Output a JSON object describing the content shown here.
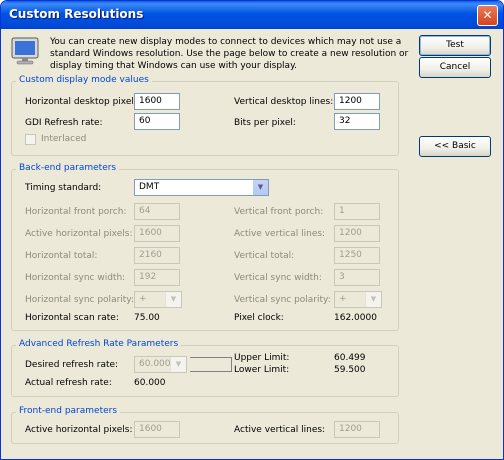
{
  "window": {
    "title": "Custom Resolutions",
    "close_glyph": "✕"
  },
  "intro": "You can create new display modes to connect to devices which may not use a standard Windows resolution. Use the page below to create a new resolution or display timing that Windows can use with your display.",
  "buttons": {
    "test": "Test",
    "cancel": "Cancel",
    "basic": "<< Basic"
  },
  "custom_mode": {
    "legend": "Custom display mode values",
    "h_pixels_label": "Horizontal desktop pixels:",
    "h_pixels": "1600",
    "v_lines_label": "Vertical desktop lines:",
    "v_lines": "1200",
    "gdi_label": "GDI Refresh rate:",
    "gdi": "60",
    "bpp_label": "Bits per pixel:",
    "bpp": "32",
    "interlaced_label": "Interlaced"
  },
  "backend": {
    "legend": "Back-end parameters",
    "timing_label": "Timing standard:",
    "timing": "DMT",
    "h_front_porch_label": "Horizontal front porch:",
    "h_front_porch": "64",
    "v_front_porch_label": "Vertical front porch:",
    "v_front_porch": "1",
    "active_h_label": "Active horizontal pixels:",
    "active_h": "1600",
    "active_v_label": "Active vertical lines:",
    "active_v": "1200",
    "h_total_label": "Horizontal total:",
    "h_total": "2160",
    "v_total_label": "Vertical total:",
    "v_total": "1250",
    "h_sync_width_label": "Horizontal sync width:",
    "h_sync_width": "192",
    "v_sync_width_label": "Vertical sync width:",
    "v_sync_width": "3",
    "h_sync_pol_label": "Horizontal sync polarity:",
    "h_sync_pol": "+",
    "v_sync_pol_label": "Vertical sync polarity:",
    "v_sync_pol": "+",
    "h_scan_label": "Horizontal scan rate:",
    "h_scan": "75.00",
    "pixel_clock_label": "Pixel clock:",
    "pixel_clock": "162.0000"
  },
  "advanced": {
    "legend": "Advanced Refresh Rate Parameters",
    "desired_label": "Desired refresh rate:",
    "desired": "60.000",
    "upper_label": "Upper Limit:",
    "upper": "60.499",
    "lower_label": "Lower Limit:",
    "lower": "59.500",
    "actual_label": "Actual refresh rate:",
    "actual": "60.000"
  },
  "frontend": {
    "legend": "Front-end parameters",
    "active_h_label": "Active horizontal pixels:",
    "active_h": "1600",
    "active_v_label": "Active vertical lines:",
    "active_v": "1200"
  },
  "icons": {
    "monitor": "monitor-icon",
    "dropdown": "chevron-down-icon",
    "close": "close-icon"
  },
  "colors": {
    "titlebar": "#0054e3",
    "legend_text": "#0046d5",
    "dialog_bg": "#ece9d8"
  }
}
